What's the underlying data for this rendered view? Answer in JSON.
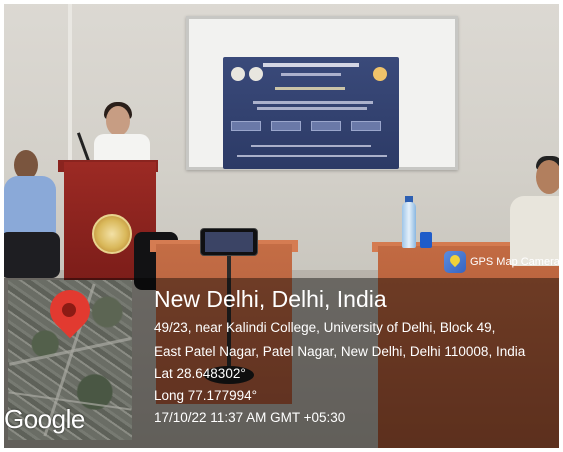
{
  "gps_stamp": {
    "place": "New Delhi, Delhi, India",
    "address_line1": "49/23, near Kalindi College, University of Delhi, Block 49,",
    "address_line2": "East Patel Nagar, Patel Nagar, New Delhi, Delhi 110008, India",
    "latitude": "Lat 28.648302°",
    "longitude": "Long 77.177994°",
    "datetime": "17/10/22 11:37 AM GMT +05:30",
    "app_name": "GPS Map Camera",
    "map_provider": "Google"
  },
  "colors": {
    "podium": "#8a241f",
    "pin": "#e23a30",
    "table": "#c46d45"
  }
}
